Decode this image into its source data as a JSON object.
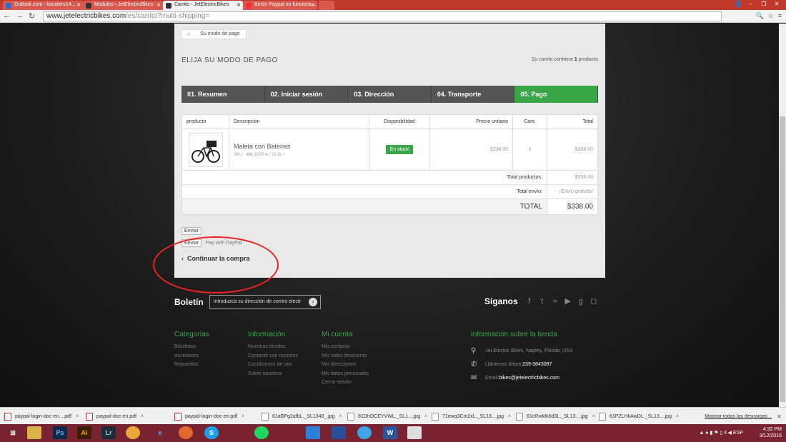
{
  "browser": {
    "tabs": [
      {
        "label": "Outlook.com - kavalero14..."
      },
      {
        "label": "Modules • JetElectricBikes"
      },
      {
        "label": "Carrito - JetElectricBikes"
      },
      {
        "label": "Botón Paypal no funciona ..."
      }
    ],
    "active_tab": 2,
    "url_host": "www.jetelectricbikes.com",
    "url_path": "/es/carrito?multi-shipping="
  },
  "page": {
    "breadcrumb": "Su modo de pago",
    "heading": "ELIJA SU MODO DE PAGO",
    "cart_info_prefix": "Su carrito contiene ",
    "cart_info_count": "1",
    "cart_info_suffix": " producto",
    "steps": [
      "01. Resumen",
      "02. Iniciar sesión",
      "03. Dirección",
      "04. Transporte",
      "05. Pago"
    ],
    "active_step": 4,
    "table": {
      "headers": [
        "producto",
        "Descripción",
        "Disponibilidad",
        "Precio unitario",
        "Cant.",
        "Total"
      ],
      "product": {
        "name": "Maleta con Baterias",
        "sku": "SKU : 48v 1000 w / 33 lb. /",
        "availability": "En stock",
        "unit_price": "$338.00",
        "qty": "1",
        "total": "$338.00"
      },
      "total_products_label": "Total productos:",
      "total_products_value": "$338.00",
      "total_shipping_label": "Total envío:",
      "total_shipping_value": "¡Envío gratuito!",
      "total_label": "TOTAL",
      "total_value": "$338.00"
    },
    "pay_buttons": [
      {
        "img_alt": "Enviar",
        "text": ""
      },
      {
        "img_alt": "Enviar",
        "text": "Pay with PayPal"
      }
    ],
    "continue_label": "Continuar la compra"
  },
  "footer": {
    "newsletter_label": "Boletín",
    "newsletter_placeholder": "Introduzca su dirección de correo electr",
    "social_label": "Síganos",
    "columns": [
      {
        "title": "Categorías",
        "items": [
          "Bicicletas",
          "Accesorios",
          "Repuestos"
        ]
      },
      {
        "title": "Información",
        "items": [
          "Nuestras tiendas",
          "Contacte con nosotros",
          "Condiciones de uso",
          "Sobre nosotros"
        ]
      },
      {
        "title": "Mi cuenta",
        "items": [
          "Mis compras",
          "Mis vales descuento",
          "Mis direcciones",
          "Mis datos personales",
          "Cerrar sesión"
        ]
      }
    ],
    "store": {
      "title": "Información sobre la tienda",
      "address": "Jet Electric Bikes, Naples, Florida, USA",
      "phone_label": "Llámenos ahora: ",
      "phone": "239-3843087",
      "email_label": "Email: ",
      "email": "bikes@jetelectricbikes.com"
    }
  },
  "downloads": {
    "items": [
      {
        "name": "paypal-login-doc-en....pdf",
        "type": "pdf"
      },
      {
        "name": "paypal-doc-en.pdf",
        "type": "pdf"
      },
      {
        "name": "paypal-login-doc-en.pdf",
        "type": "pdf"
      },
      {
        "name": "61aBPg2afbL._SL1348_.jpg",
        "type": "jpg"
      },
      {
        "name": "81DhOCEYVWL._SL1....jpg",
        "type": "jpg"
      },
      {
        "name": "71ewq3Cm2xL._SL13....jpg",
        "type": "jpg"
      },
      {
        "name": "61cRwMk6d3L._SL13....jpg",
        "type": "jpg"
      },
      {
        "name": "61PZLHkAwDL._SL13....jpg",
        "type": "jpg"
      }
    ],
    "show_all": "Mostrar todas las descargas..."
  },
  "taskbar": {
    "lang": "ESP",
    "time": "4:32 PM",
    "date": "3/12/2016"
  },
  "colors": {
    "accent": "#3aa648",
    "annotation": "#e22222"
  }
}
